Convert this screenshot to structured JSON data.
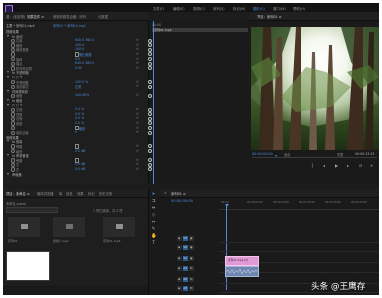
{
  "menu": {
    "items": [
      "文件(F)",
      "编辑(E)",
      "剪辑(C)",
      "序列(S)",
      "标记(M)",
      "图形(G)",
      "窗口(W)",
      "帮助(H)"
    ],
    "active_index": 5,
    "app_icon": "premiere-app-icon"
  },
  "effect_controls": {
    "tabs": [
      "源：(无剪辑)",
      "效果控件 ≡",
      "音频剪辑混合器：序列",
      "元数据"
    ],
    "active_tab": 1,
    "source_label": "主要 * 序列01.mp4",
    "sequence_label": "序列01 * 序列01.mp4",
    "timecode_header": "00:00",
    "clip_name": "序列01.mp4",
    "sections": [
      {
        "label": "视频效果",
        "type": "section"
      },
      {
        "label": "fx 运动",
        "type": "group"
      },
      {
        "label": "位置",
        "value": "640.0   360.0"
      },
      {
        "label": "缩放",
        "value": "100.0"
      },
      {
        "label": "缩放宽度",
        "value": "100.0"
      },
      {
        "label": "",
        "value": "等比缩放",
        "checkbox": true
      },
      {
        "label": "旋转",
        "value": "0.0"
      },
      {
        "label": "锚点",
        "value": "640.0   360.0"
      },
      {
        "label": "防闪烁滤镜",
        "value": "0.00"
      },
      {
        "label": "fx 不透明度",
        "type": "group"
      },
      {
        "label": "○ □ ✎",
        "type": "masks"
      },
      {
        "label": "不透明度",
        "value": "100.0 %"
      },
      {
        "label": "混合模式",
        "value": "正常"
      },
      {
        "label": "时间重映射",
        "type": "group"
      },
      {
        "label": "速度",
        "value": "100.00%"
      },
      {
        "label": "fx 裁剪",
        "type": "group"
      },
      {
        "label": "○ □ ✎",
        "type": "masks"
      },
      {
        "label": "左侧",
        "value": "0.0 %"
      },
      {
        "label": "顶部",
        "value": "0.0 %"
      },
      {
        "label": "右侧",
        "value": "0.0 %"
      },
      {
        "label": "底部",
        "value": "0.0 %"
      },
      {
        "label": "",
        "value": "缩放",
        "checkbox": true
      },
      {
        "label": "羽化边缘",
        "value": "0"
      },
      {
        "label": "音频效果",
        "type": "section"
      },
      {
        "label": "fx 音量",
        "type": "group"
      },
      {
        "label": "旁路",
        "value": "",
        "checkbox": true
      },
      {
        "label": "级别",
        "value": "0.0 dB"
      },
      {
        "label": "fx 声道音量",
        "type": "group"
      },
      {
        "label": "旁路",
        "value": "",
        "checkbox": true
      },
      {
        "label": "左",
        "value": "0.0 dB"
      },
      {
        "label": "右",
        "value": "0.0 dB"
      },
      {
        "label": "声像器",
        "type": "group"
      }
    ],
    "footer_timecode": "00:00:00:00"
  },
  "program": {
    "title": "节目：序列01 ≡",
    "timecode": "00:00:00:00",
    "zoom": "适合",
    "fraction": "完整",
    "end_timecode": "00:00:13:15"
  },
  "project": {
    "tabs": [
      "项目：未命名 ≡",
      "媒体浏览器",
      "库",
      "信息",
      "效果",
      "标记",
      "历史记录"
    ],
    "project_file": "未命名.prproj",
    "search_placeholder": "",
    "item_count": "1 项已选择，共 3 项",
    "bins": [
      {
        "name": "序列01",
        "icon": "folder-icon"
      },
      {
        "name": "视频1.mp4",
        "icon": "clip-icon"
      },
      {
        "name": "序列01.mp4",
        "icon": "clip-icon"
      }
    ]
  },
  "timeline": {
    "tab": "序列01 ≡",
    "timecode": "00:00:00:00",
    "ruler": [
      "00:00",
      "00:00:05:00",
      "00:00:10:00",
      "00:00:15:00",
      "00:00:20:00",
      "00:00:25:00"
    ],
    "tracks": [
      "V3",
      "V2",
      "V1",
      "A1",
      "A2",
      "A3"
    ],
    "clip_video_label": "序列01.mp4 [V]",
    "clip_audio_label": ""
  },
  "watermark": {
    "text": "头条 @王鹰存"
  },
  "colors": {
    "accent_blue": "#4c8dd9",
    "clip_pink": "#e19ad6",
    "clip_audio": "#6f86b0",
    "playhead": "#4f88d8"
  }
}
